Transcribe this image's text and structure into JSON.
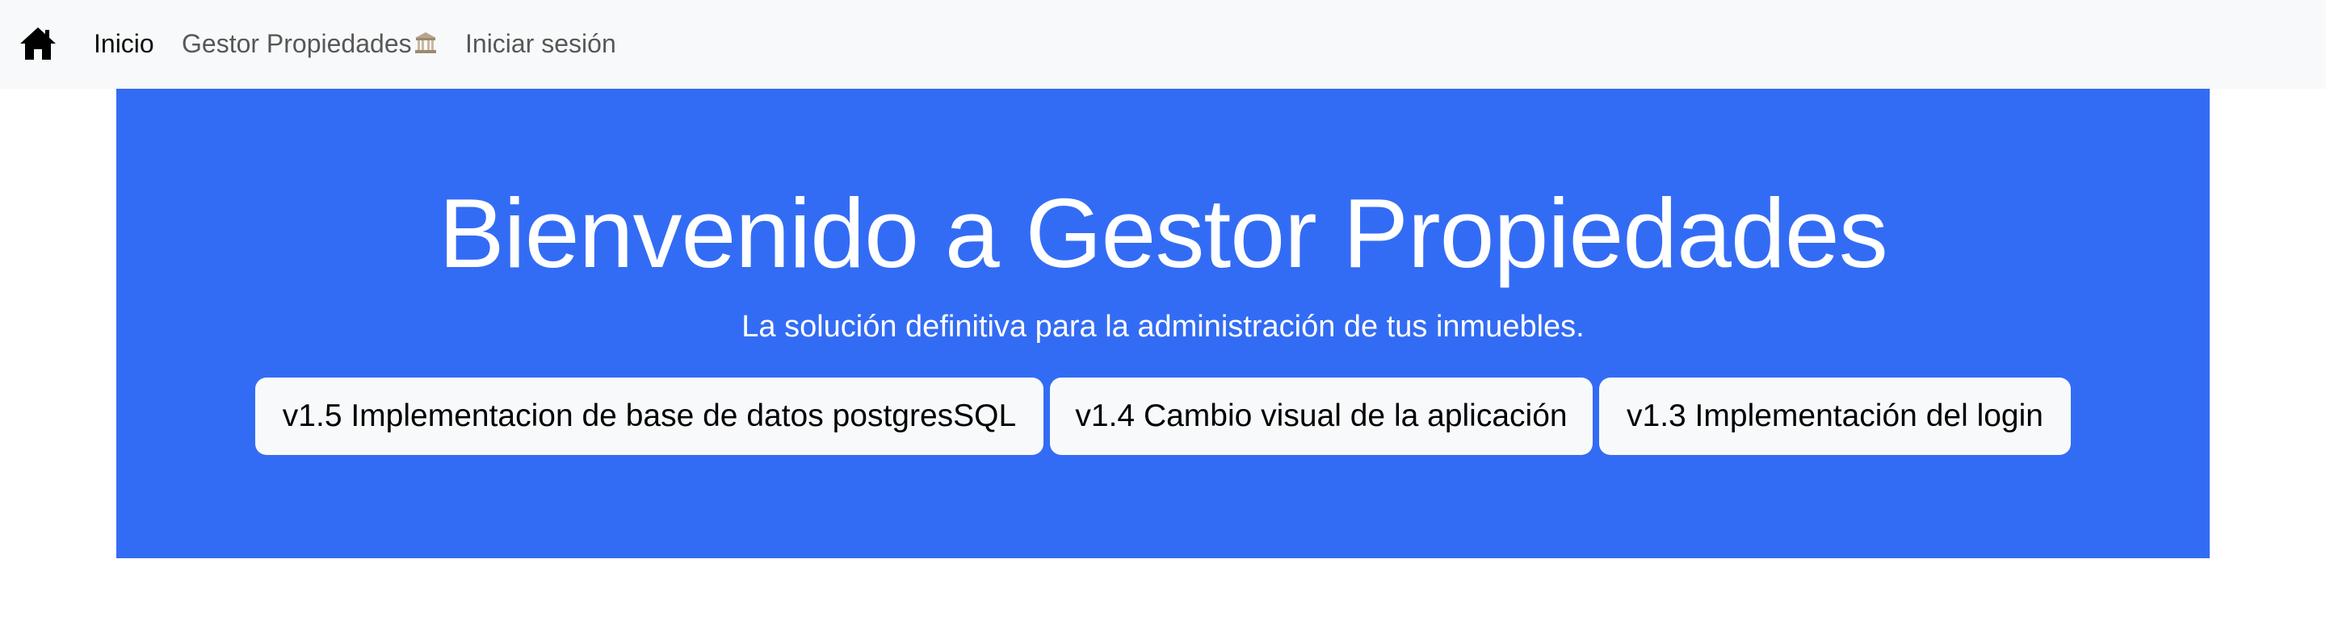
{
  "navbar": {
    "home_icon": "house-icon",
    "items": [
      {
        "label": "Inicio",
        "active": true
      },
      {
        "label": "Gestor Propiedades",
        "emoji": "🏛️",
        "active": false
      },
      {
        "label": "Iniciar sesión",
        "active": false
      }
    ]
  },
  "hero": {
    "title": "Bienvenido a Gestor Propiedades",
    "subtitle": "La solución definitiva para la administración de tus inmuebles.",
    "background_color": "#336cf4",
    "version_buttons": [
      {
        "label": "v1.5 Implementacion de base de datos postgresSQL"
      },
      {
        "label": "v1.4 Cambio visual de la aplicación"
      },
      {
        "label": "v1.3 Implementación del login"
      }
    ]
  }
}
